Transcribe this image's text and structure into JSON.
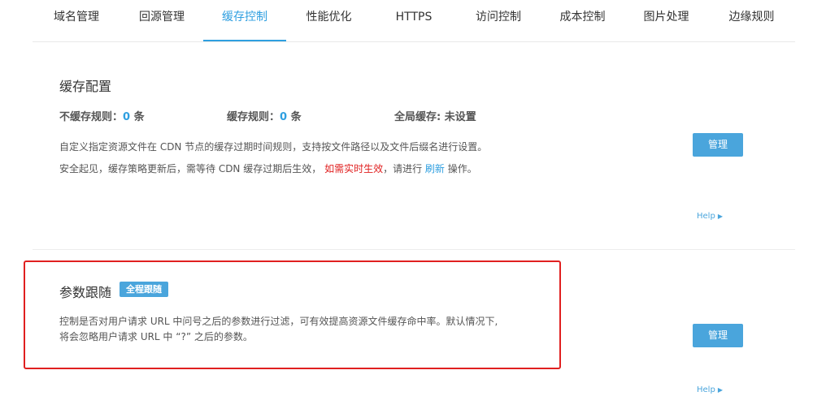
{
  "tabs": [
    {
      "label": "域名管理"
    },
    {
      "label": "回源管理"
    },
    {
      "label": "缓存控制"
    },
    {
      "label": "性能优化"
    },
    {
      "label": "HTTPS"
    },
    {
      "label": "访问控制"
    },
    {
      "label": "成本控制"
    },
    {
      "label": "图片处理"
    },
    {
      "label": "边缘规则"
    }
  ],
  "active_tab": "缓存控制",
  "cache_config": {
    "title": "缓存配置",
    "no_cache_label": "不缓存规则：",
    "no_cache_value": "0",
    "no_cache_unit": "条",
    "cache_label": "缓存规则：",
    "cache_value": "0",
    "cache_unit": "条",
    "global_label": "全局缓存:",
    "global_value": "未设置",
    "desc1": "自定义指定资源文件在 CDN 节点的缓存过期时间规则，支持按文件路径以及文件后缀名进行设置。",
    "desc2_prefix": "安全起见，缓存策略更新后，需等待 CDN 缓存过期后生效，",
    "desc2_red": "如需实时生效",
    "desc2_mid": "，请进行",
    "desc2_link": "刷新",
    "desc2_suffix": "操作。",
    "manage_label": "管理",
    "help_label": "Help"
  },
  "param_follow": {
    "title": "参数跟随",
    "badge": "全程跟随",
    "desc1": "控制是否对用户请求 URL 中问号之后的参数进行过滤，可有效提高资源文件缓存命中率。默认情况下,",
    "desc2": "将会忽略用户请求 URL 中 “?” 之后的参数。",
    "manage_label": "管理",
    "help_label": "Help"
  },
  "colors": {
    "accent": "#2f9fe0",
    "button": "#4aa5dc",
    "highlight_red": "#e02020"
  }
}
